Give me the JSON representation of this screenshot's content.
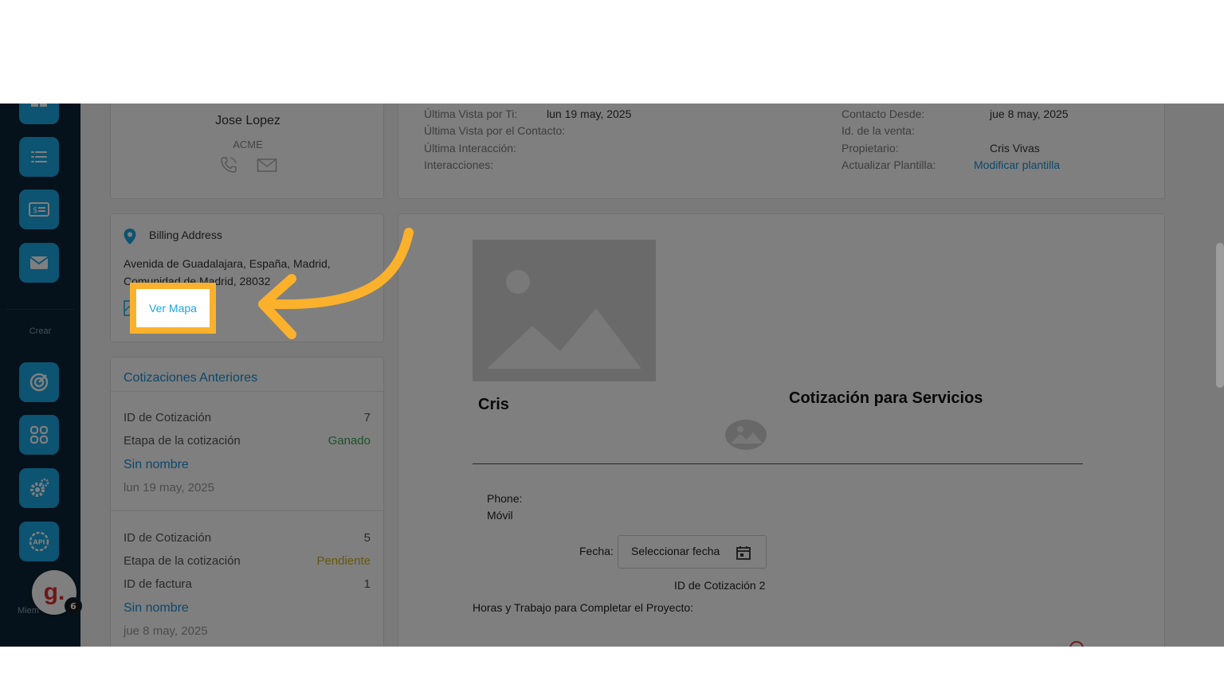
{
  "contact": {
    "name": "Jose Lopez",
    "company": "ACME"
  },
  "info": {
    "ultima_vista_label": "Última Vista por Ti:",
    "ultima_vista_value": "lun 19 may, 2025",
    "ultima_vista_contacto_label": "Última Vista por el Contacto:",
    "ultima_interaccion_label": "Última Interacción:",
    "interacciones_label": "Interacciones:",
    "contacto_desde_label": "Contacto Desde:",
    "contacto_desde_value": "jue 8 may, 2025",
    "id_venta_label": "Id. de la venta:",
    "propietario_label": "Propietario:",
    "propietario_value": "Cris Vivas",
    "actualizar_label": "Actualizar Plantilla:",
    "modificar_link": "Modificar plantilla"
  },
  "billing": {
    "title": "Billing Address",
    "address_line1": "Avenida de Guadalajara, España, Madrid,",
    "address_line2": "Comunidad de Madrid, 28032",
    "map_link": "Ver Mapa"
  },
  "quotes": {
    "title": "Cotizaciones Anteriores",
    "items": [
      {
        "id_label": "ID de Cotización",
        "id_value": "7",
        "stage_label": "Etapa de la cotización",
        "stage_value": "Ganado",
        "stage_color": "#3aa657",
        "name": "Sin nombre",
        "date": "lun 19 may, 2025"
      },
      {
        "id_label": "ID de Cotización",
        "id_value": "5",
        "stage_label": "Etapa de la cotización",
        "stage_value": "Pendiente",
        "stage_color": "#c9b21a",
        "invoice_label": "ID de factura",
        "invoice_value": "1",
        "name": "Sin nombre",
        "date": "jue 8 may, 2025"
      }
    ]
  },
  "document": {
    "company": "Cris",
    "title": "Cotización para Servicios",
    "phone_label": "Phone:",
    "movil_label": "Móvil",
    "fecha_label": "Fecha:",
    "date_placeholder": "Seleccionar fecha",
    "quote_id_label": "ID de Cotización",
    "quote_id_value": "2",
    "hours_label": "Horas y Trabajo para Completar el Proyecto:"
  },
  "sidebar": {
    "crear_label": "Crear",
    "miembros_label": "Miem",
    "avatar_letter": "g.",
    "badge_count": "6"
  },
  "colors": {
    "accent": "#1aa6e5",
    "highlight": "#fbb12b",
    "sidebar_bg": "#0b2536"
  }
}
